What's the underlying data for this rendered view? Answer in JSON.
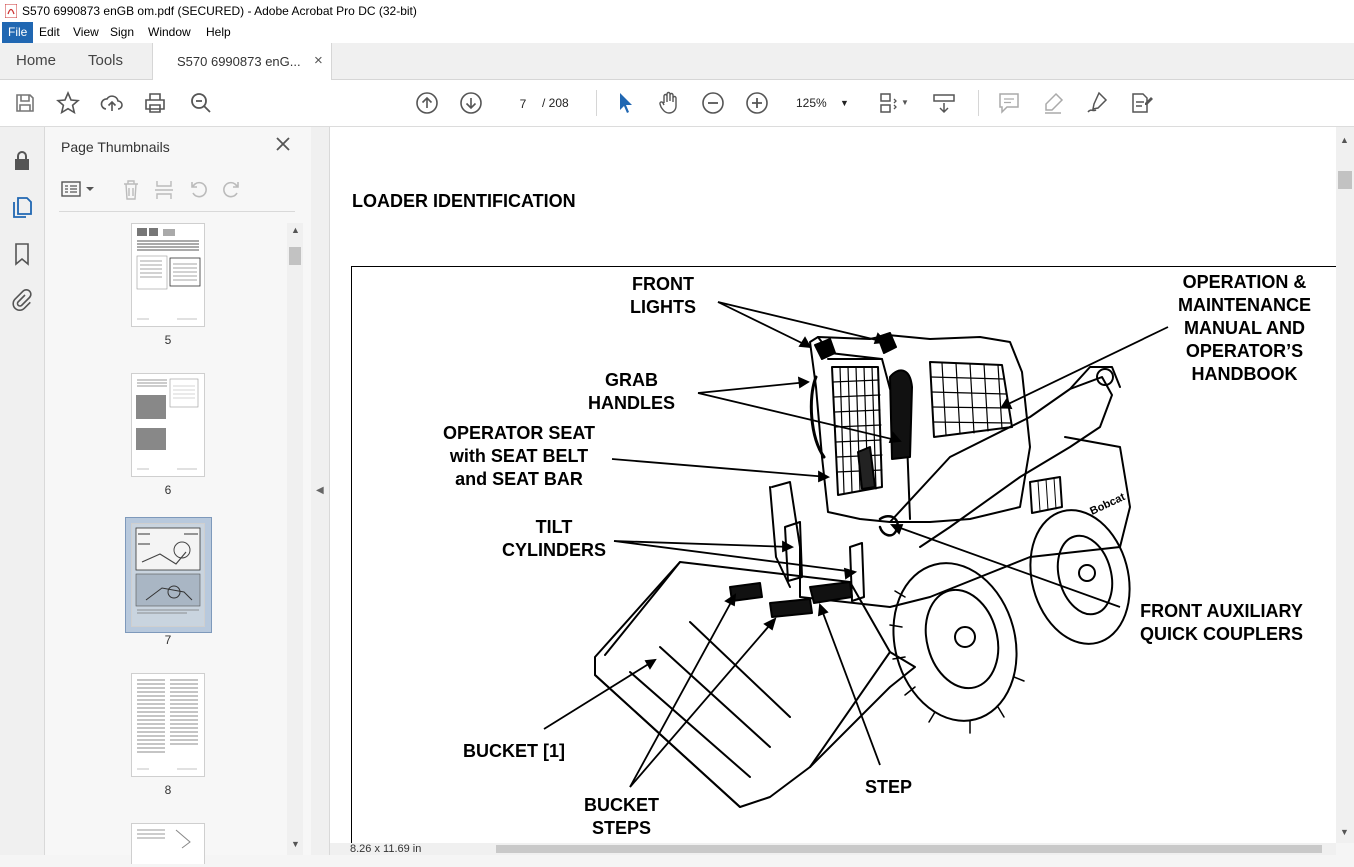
{
  "window": {
    "title": "S570 6990873 enGB om.pdf (SECURED) - Adobe Acrobat Pro DC (32-bit)"
  },
  "menu": [
    "File",
    "Edit",
    "View",
    "Sign",
    "Window",
    "Help"
  ],
  "tabs": {
    "home": "Home",
    "tools": "Tools",
    "document": "S570 6990873 enG...",
    "close": "×"
  },
  "toolbar": {
    "current_page": "7",
    "page_total": "/ 208",
    "zoom": "125%",
    "icons": [
      "save-icon",
      "star-icon",
      "upload-icon",
      "print-icon",
      "search-zoom-icon",
      "page-up-icon",
      "page-down-icon",
      "select-cursor-icon",
      "hand-icon",
      "zoom-out-icon",
      "zoom-in-icon",
      "fit-page-icon",
      "scroll-mode-icon",
      "comment-icon",
      "highlight-icon",
      "sign-icon",
      "redact-icon"
    ]
  },
  "left_rail": {
    "icons": [
      "lock-icon",
      "pages-icon",
      "bookmark-icon",
      "attachment-icon"
    ]
  },
  "thumbnails": {
    "title": "Page Thumbnails",
    "pages": [
      {
        "label": "5",
        "selected": false
      },
      {
        "label": "6",
        "selected": false
      },
      {
        "label": "7",
        "selected": true
      },
      {
        "label": "8",
        "selected": false
      }
    ]
  },
  "document": {
    "heading": "LOADER IDENTIFICATION",
    "callouts": {
      "front_lights": "FRONT\nLIGHTS",
      "operation_manual": "OPERATION &\nMAINTENANCE\nMANUAL AND\nOPERATOR’S\nHANDBOOK",
      "grab_handles": "GRAB\nHANDLES",
      "operator_seat": "OPERATOR SEAT\nwith SEAT BELT\nand SEAT BAR",
      "tilt_cylinders": "TILT\nCYLINDERS",
      "front_aux": "FRONT AUXILIARY\nQUICK COUPLERS",
      "bucket": "BUCKET [1]",
      "step": "STEP",
      "bucket_steps": "BUCKET\nSTEPS"
    },
    "brand_mark": "Bobcat"
  },
  "status": {
    "page_size": "8.26 x 11.69 in"
  },
  "colors": {
    "accent": "#2067b2",
    "selected_thumb": "#b8c9dd"
  }
}
